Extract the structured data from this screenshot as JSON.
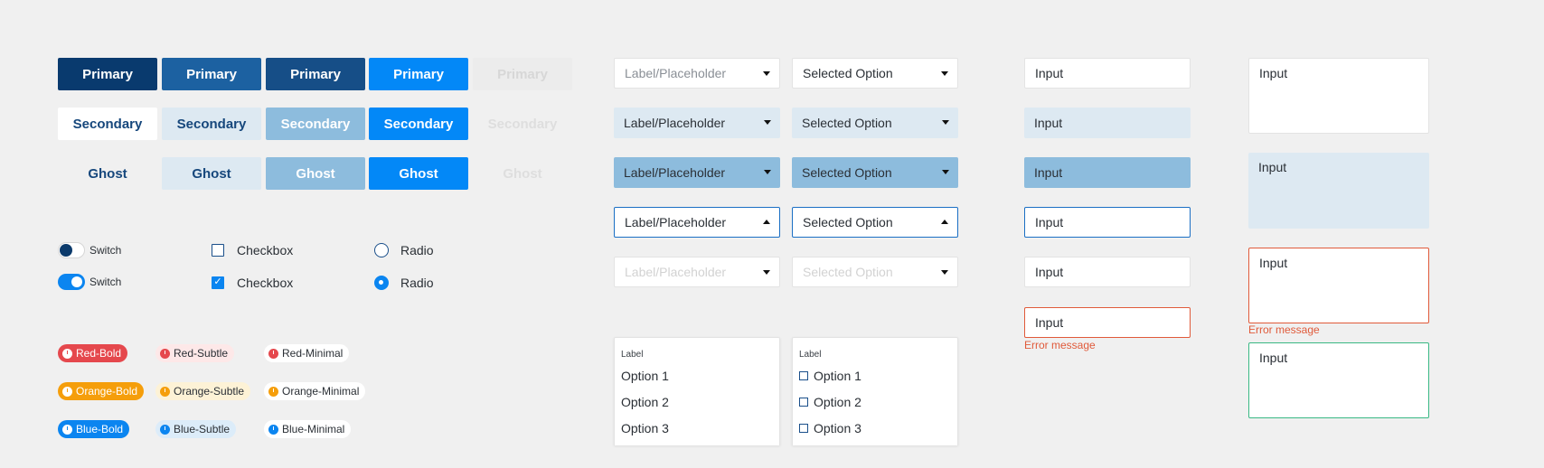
{
  "buttons": {
    "primary": "Primary",
    "secondary": "Secondary",
    "ghost": "Ghost"
  },
  "controls": {
    "switch_label": "Switch",
    "checkbox_label": "Checkbox",
    "radio_label": "Radio",
    "switch_off_state": false,
    "switch_on_state": true
  },
  "tags": {
    "red_bold": "Red-Bold",
    "red_subtle": "Red-Subtle",
    "red_minimal": "Red-Minimal",
    "orange_bold": "Orange-Bold",
    "orange_subtle": "Orange-Subtle",
    "orange_minimal": "Orange-Minimal",
    "blue_bold": "Blue-Bold",
    "blue_subtle": "Blue-Subtle",
    "blue_minimal": "Blue-Minimal"
  },
  "dropdowns": {
    "placeholder": "Label/Placeholder",
    "selected": "Selected Option",
    "menu_label": "Label",
    "options": [
      "Option 1",
      "Option 2",
      "Option 3"
    ]
  },
  "inputs": {
    "value": "Input",
    "error_message": "Error message"
  },
  "colors": {
    "primary_dark": "#093a6e",
    "accent_blue": "#0388f7",
    "error": "#e05a3a",
    "success": "#39b884",
    "red": "#e5484d",
    "orange": "#f59e0b"
  }
}
